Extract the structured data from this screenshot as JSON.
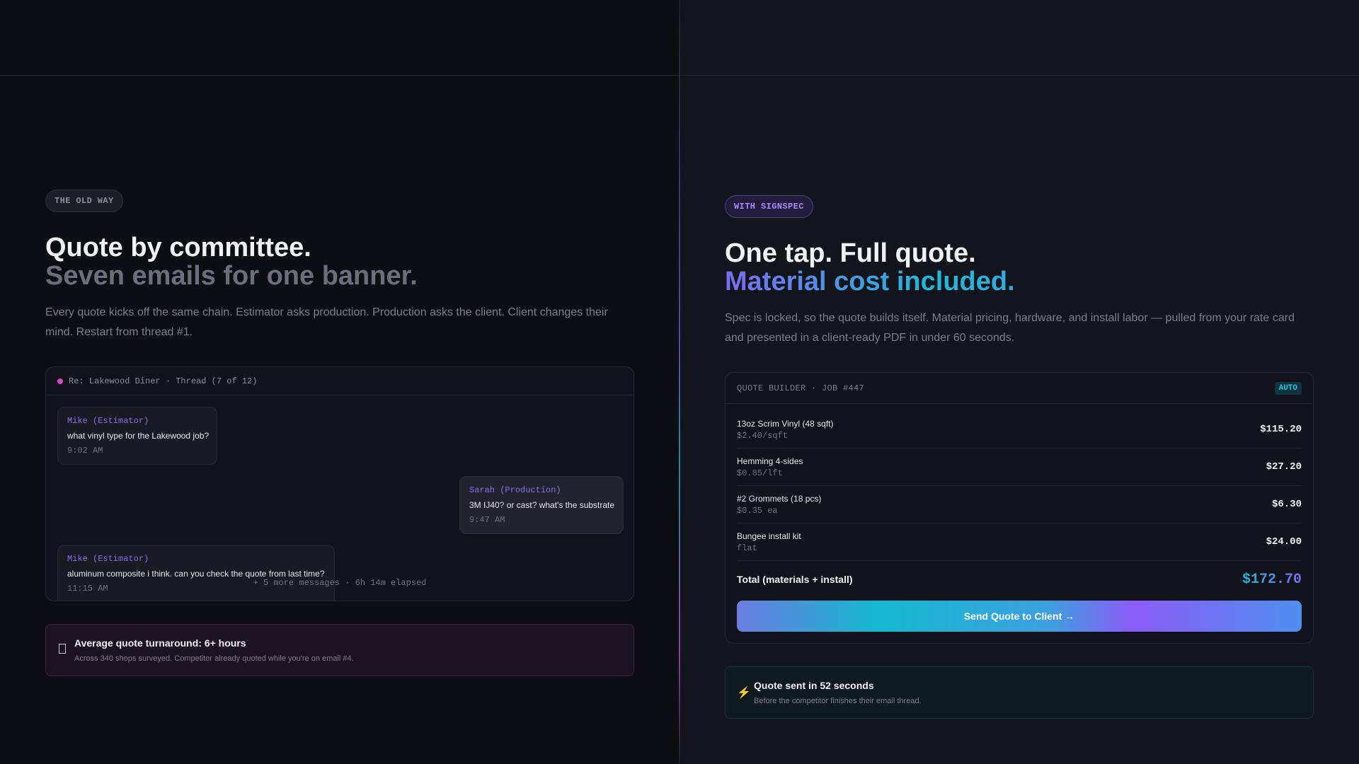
{
  "old_way": {
    "badge": "THE OLD WAY",
    "headline_1": "Quote by committee.",
    "headline_2": "Seven emails for one banner.",
    "description": "Every quote kicks off the same chain. Estimator asks production. Production asks the client. Client changes their mind. Restart from thread #1.",
    "thread": {
      "title": "Re: Lakewood Diner · Thread (7 of 12)",
      "messages": [
        {
          "sender": "Mike (Estimator)",
          "text": "what vinyl type for the Lakewood job?",
          "time": "9:02 AM"
        },
        {
          "sender": "Sarah (Production)",
          "text": "3M IJ40? or cast? what's the substrate",
          "time": "9:47 AM"
        },
        {
          "sender": "Mike (Estimator)",
          "text": "aluminum composite i think. can you check the quote from last time?",
          "time": "11:15 AM"
        }
      ],
      "more": "+ 5 more messages · 6h 14m elapsed"
    },
    "callout": {
      "icon": "hourglass-icon",
      "title": "Average quote turnaround: 6+ hours",
      "subtitle": "Across 340 shops surveyed. Competitor already quoted while you're on email #4."
    }
  },
  "new_way": {
    "badge": "WITH SIGNSPEC",
    "headline_1": "One tap. Full quote.",
    "headline_2": "Material cost included.",
    "description": "Spec is locked, so the quote builds itself. Material pricing, hardware, and install labor — pulled from your rate card and presented in a client-ready PDF in under 60 seconds.",
    "quote_builder": {
      "title": "QUOTE BUILDER · JOB #447",
      "badge": "AUTO",
      "items": [
        {
          "name": "13oz Scrim Vinyl (48 sqft)",
          "rate": "$2.40/sqft",
          "price": "$115.20"
        },
        {
          "name": "Hemming 4-sides",
          "rate": "$0.85/lft",
          "price": "$27.20"
        },
        {
          "name": "#2 Grommets (18 pcs)",
          "rate": "$0.35 ea",
          "price": "$6.30"
        },
        {
          "name": "Bungee install kit",
          "rate": "flat",
          "price": "$24.00"
        }
      ],
      "total_label": "Total (materials + install)",
      "total_value": "$172.70",
      "button": "Send Quote to Client →"
    },
    "callout": {
      "icon": "lightning-icon",
      "glyph": "⚡",
      "title": "Quote sent in 52 seconds",
      "subtitle": "Before the competitor finishes their email thread."
    }
  },
  "colors": {
    "accent_purple": "#8b6cf0",
    "accent_cyan": "#22b8d8",
    "accent_pink": "#d946c8"
  }
}
